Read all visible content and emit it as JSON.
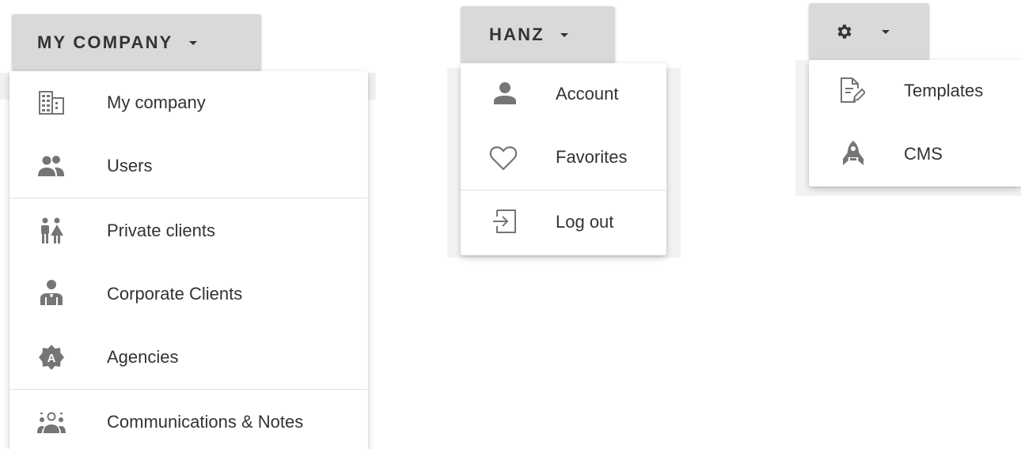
{
  "menus": {
    "company": {
      "button_label": "MY COMPANY",
      "items": [
        {
          "label": "My company",
          "icon": "office-building-icon"
        },
        {
          "label": "Users",
          "icon": "users-icon"
        },
        {
          "label": "Private clients",
          "icon": "private-clients-icon"
        },
        {
          "label": "Corporate Clients",
          "icon": "corporate-clients-icon"
        },
        {
          "label": "Agencies",
          "icon": "agency-badge-icon"
        },
        {
          "label": "Communications & Notes",
          "icon": "communications-icon"
        }
      ]
    },
    "user": {
      "button_label": "HANZ",
      "items": [
        {
          "label": "Account",
          "icon": "account-icon"
        },
        {
          "label": "Favorites",
          "icon": "heart-outline-icon"
        },
        {
          "label": "Log out",
          "icon": "logout-icon"
        }
      ]
    },
    "settings": {
      "button_icon": "gear-icon",
      "items": [
        {
          "label": "Templates",
          "icon": "file-edit-icon"
        },
        {
          "label": "CMS",
          "icon": "rocket-icon"
        }
      ]
    }
  },
  "colors": {
    "button_bg": "#d9d9d9",
    "icon_gray": "#757575",
    "text": "#333333",
    "divider": "#e0e0e0"
  }
}
